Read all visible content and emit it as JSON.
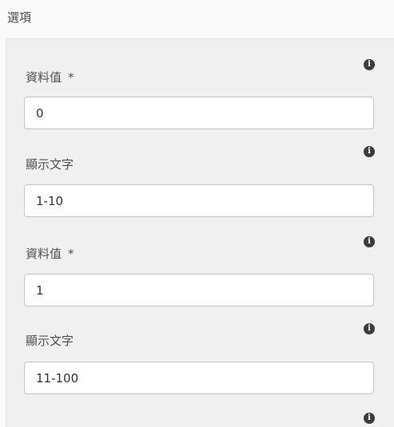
{
  "section": {
    "title": "選項"
  },
  "options": [
    {
      "value_field": {
        "label": "資料值",
        "required_mark": "*",
        "value": "0",
        "info_icon": "info-icon"
      },
      "text_field": {
        "label": "顯示文字",
        "value": "1-10",
        "info_icon": "info-icon"
      }
    },
    {
      "value_field": {
        "label": "資料值",
        "required_mark": "*",
        "value": "1",
        "info_icon": "info-icon"
      },
      "text_field": {
        "label": "顯示文字",
        "value": "11-100",
        "info_icon": "info-icon"
      }
    }
  ],
  "trailing_info_icon": "info-icon",
  "colors": {
    "page_background": "#fafafa",
    "panel_background": "#f0f0f0",
    "input_border": "#c4c4c4",
    "icon": "#3c3c3c"
  }
}
